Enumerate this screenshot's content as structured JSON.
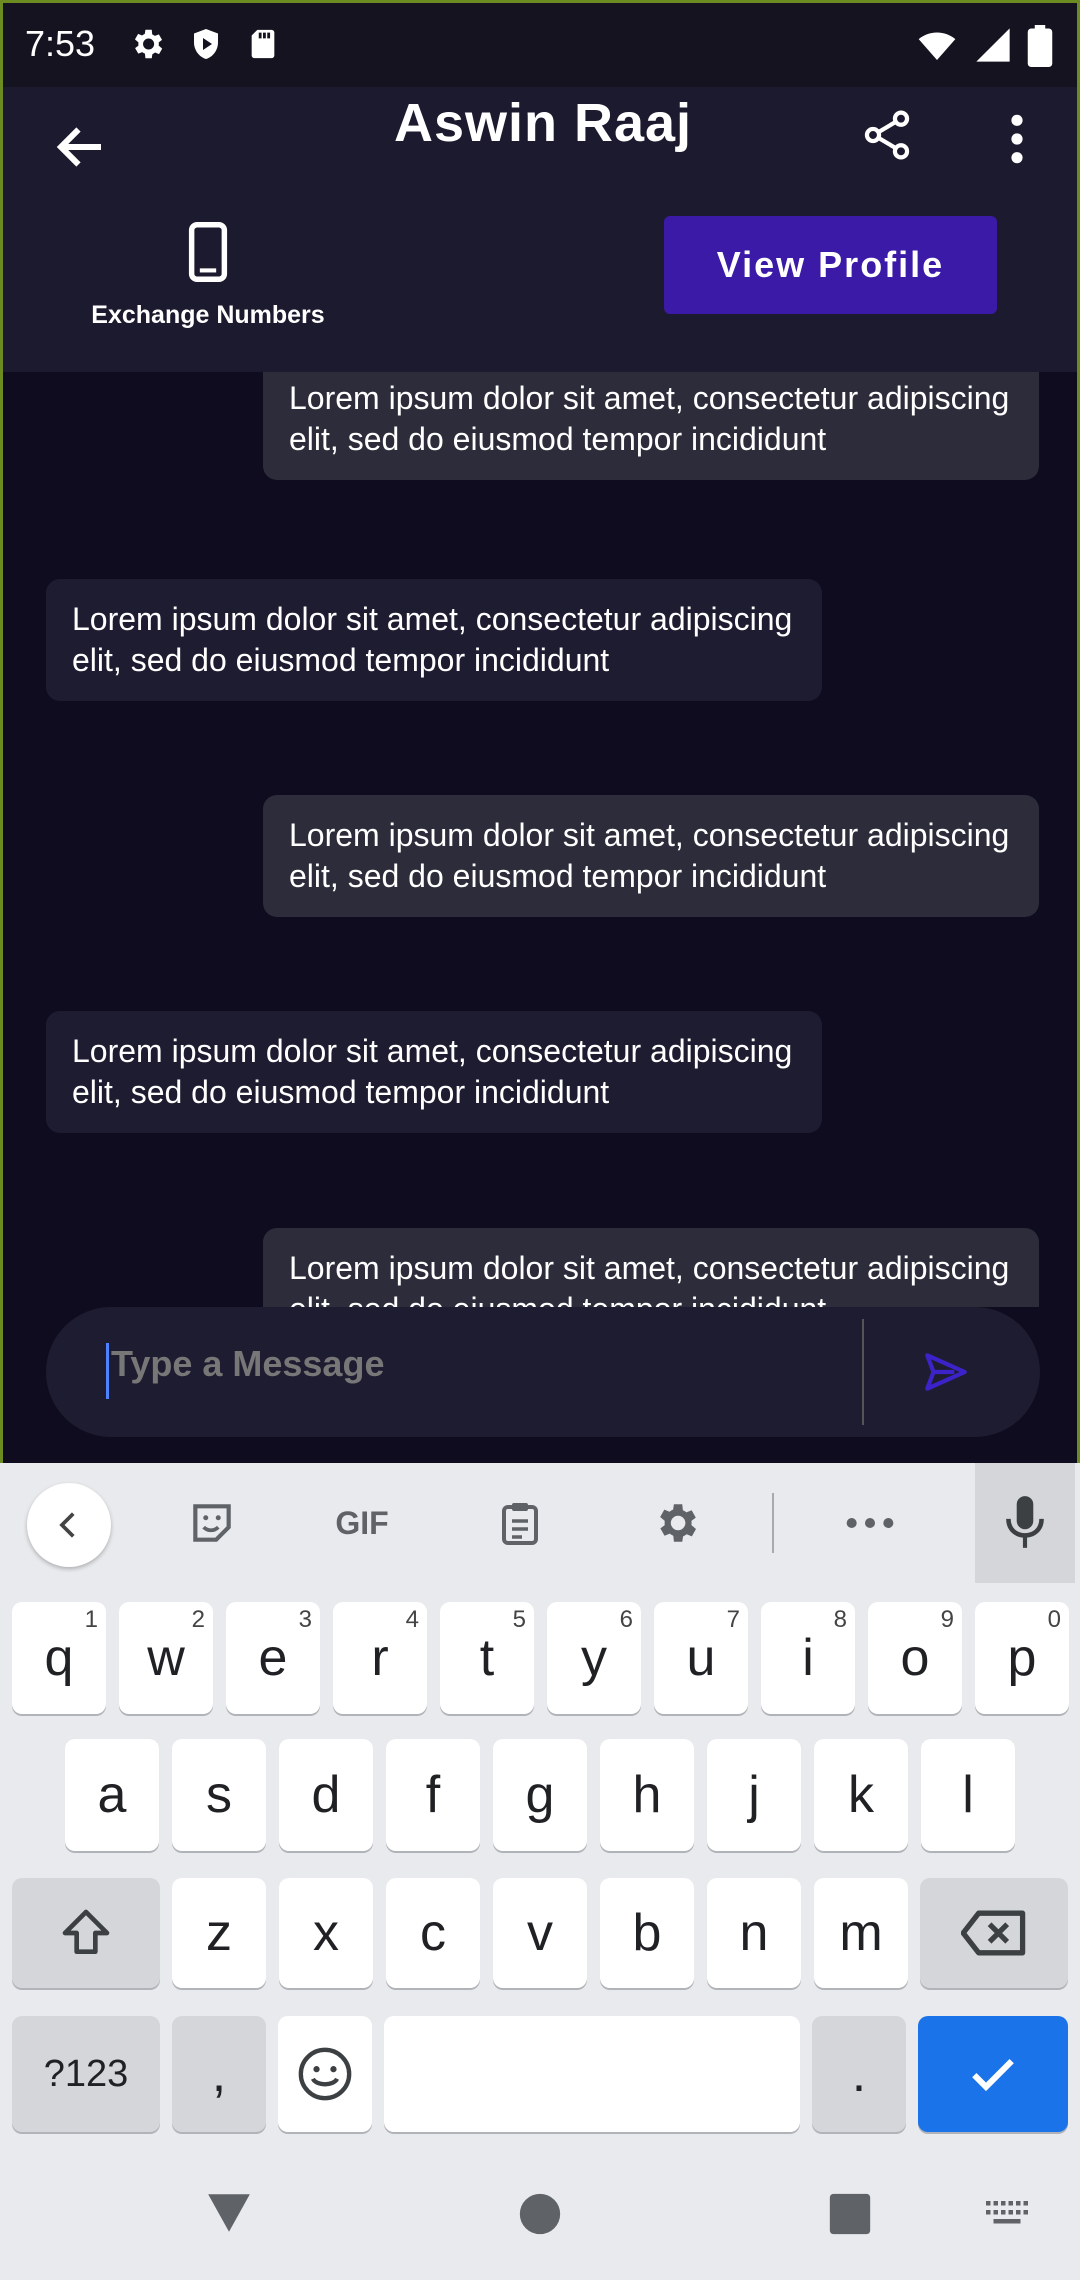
{
  "status_bar": {
    "time": "7:53"
  },
  "header": {
    "title": "Aswin Raaj",
    "exchange_label": "Exchange Numbers",
    "view_profile_label": "View Profile"
  },
  "messages": [
    {
      "direction": "out",
      "text": "Lorem ipsum dolor sit amet, consectetur adipiscing elit, sed do eiusmod tempor incididunt"
    },
    {
      "direction": "in",
      "text": "Lorem ipsum dolor sit amet, consectetur adipiscing elit, sed do eiusmod tempor incididunt"
    },
    {
      "direction": "out",
      "text": "Lorem ipsum dolor sit amet, consectetur adipiscing elit, sed do eiusmod tempor incididunt"
    },
    {
      "direction": "in",
      "text": "Lorem ipsum dolor sit amet, consectetur adipiscing elit, sed do eiusmod tempor incididunt"
    },
    {
      "direction": "out",
      "text": "Lorem ipsum dolor sit amet, consectetur adipiscing elit, sed do eiusmod tempor incididunt"
    }
  ],
  "input": {
    "placeholder": "Type a Message"
  },
  "keyboard": {
    "toolbar": {
      "gif_label": "GIF"
    },
    "row1": [
      {
        "k": "q",
        "h": "1"
      },
      {
        "k": "w",
        "h": "2"
      },
      {
        "k": "e",
        "h": "3"
      },
      {
        "k": "r",
        "h": "4"
      },
      {
        "k": "t",
        "h": "5"
      },
      {
        "k": "y",
        "h": "6"
      },
      {
        "k": "u",
        "h": "7"
      },
      {
        "k": "i",
        "h": "8"
      },
      {
        "k": "o",
        "h": "9"
      },
      {
        "k": "p",
        "h": "0"
      }
    ],
    "row2": [
      "a",
      "s",
      "d",
      "f",
      "g",
      "h",
      "j",
      "k",
      "l"
    ],
    "row3": [
      "z",
      "x",
      "c",
      "v",
      "b",
      "n",
      "m"
    ],
    "symbols_label": "?123",
    "comma_label": ",",
    "period_label": "."
  },
  "colors": {
    "accent": "#3a1aa6",
    "send_icon": "#3b23c9",
    "enter_key": "#1a73e8"
  }
}
